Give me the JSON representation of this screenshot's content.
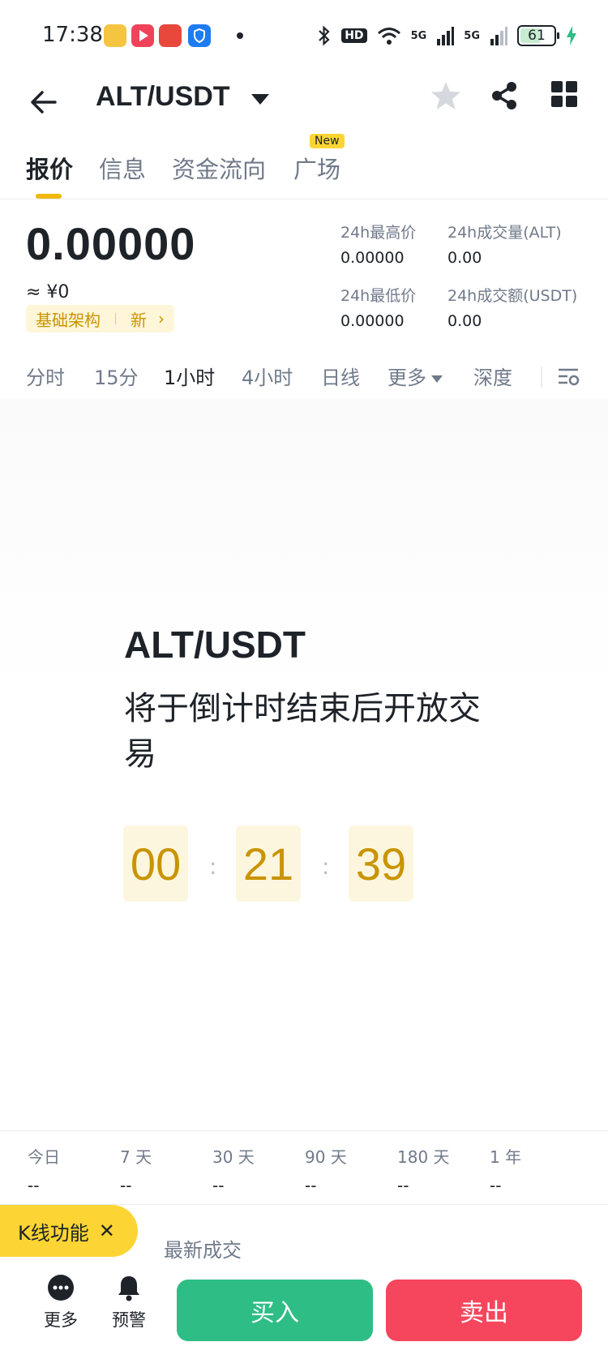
{
  "status_bar": {
    "time": "17:38",
    "network_hd": "HD",
    "network_5g_1": "5G",
    "network_5g_2": "5G",
    "battery": "61"
  },
  "header": {
    "pair": "ALT/USDT"
  },
  "tabs": [
    {
      "label": "报价",
      "active": true
    },
    {
      "label": "信息",
      "active": false
    },
    {
      "label": "资金流向",
      "active": false
    },
    {
      "label": "广场",
      "active": false,
      "badge": "New"
    }
  ],
  "ticker": {
    "price": "0.00000",
    "price_cny": "≈ ¥0",
    "tag_category": "基础架构",
    "tag_new": "新",
    "stats": [
      {
        "label": "24h最高价",
        "value": "0.00000"
      },
      {
        "label": "24h成交量(ALT)",
        "value": "0.00"
      },
      {
        "label": "24h最低价",
        "value": "0.00000"
      },
      {
        "label": "24h成交额(USDT)",
        "value": "0.00"
      }
    ]
  },
  "intervals": [
    {
      "label": "分时",
      "active": false
    },
    {
      "label": "15分",
      "active": false
    },
    {
      "label": "1小时",
      "active": true
    },
    {
      "label": "4小时",
      "active": false
    },
    {
      "label": "日线",
      "active": false
    },
    {
      "label": "更多",
      "active": false
    },
    {
      "label": "深度",
      "active": false
    }
  ],
  "countdown": {
    "pair": "ALT/USDT",
    "message": "将于倒计时结束后开放交易",
    "hours": "00",
    "minutes": "21",
    "seconds": "39",
    "separator": ":"
  },
  "periods": [
    {
      "label": "今日",
      "value": "--"
    },
    {
      "label": "7 天",
      "value": "--"
    },
    {
      "label": "30 天",
      "value": "--"
    },
    {
      "label": "90 天",
      "value": "--"
    },
    {
      "label": "180 天",
      "value": "--"
    },
    {
      "label": "1 年",
      "value": "--"
    }
  ],
  "kline_pill": {
    "label": "K线功能",
    "close": "✕"
  },
  "latest_trades": "最新成交",
  "bottom_bar": {
    "more": "更多",
    "alert": "预警",
    "buy": "买入",
    "sell": "卖出"
  },
  "colors": {
    "accent": "#f0b90b",
    "buy": "#2ebd85",
    "sell": "#f6465d",
    "countdown": "#c99400"
  }
}
